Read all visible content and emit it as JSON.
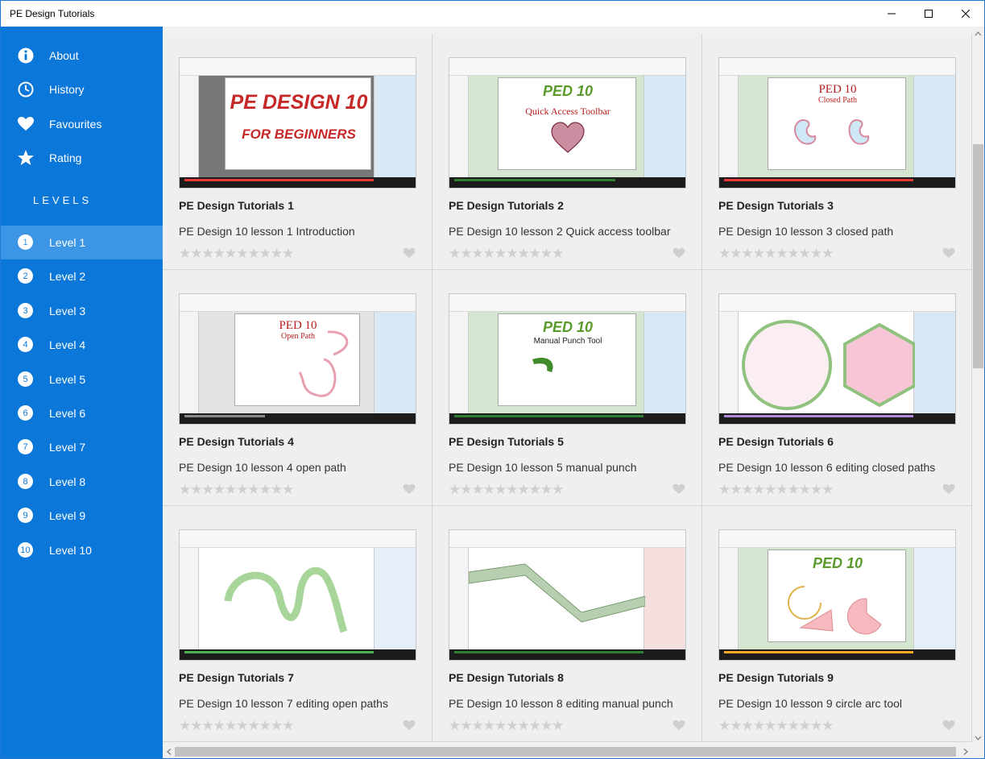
{
  "window": {
    "title": "PE Design Tutorials"
  },
  "sidebar": {
    "nav": [
      {
        "label": "About",
        "icon": "info-icon"
      },
      {
        "label": "History",
        "icon": "clock-icon"
      },
      {
        "label": "Favourites",
        "icon": "heart-icon"
      },
      {
        "label": "Rating",
        "icon": "star-icon"
      }
    ],
    "levels_heading": "LEVELS",
    "levels": [
      {
        "num": "1",
        "label": "Level 1",
        "active": true
      },
      {
        "num": "2",
        "label": "Level 2"
      },
      {
        "num": "3",
        "label": "Level 3"
      },
      {
        "num": "4",
        "label": "Level 4"
      },
      {
        "num": "5",
        "label": "Level 5"
      },
      {
        "num": "6",
        "label": "Level 6"
      },
      {
        "num": "7",
        "label": "Level 7"
      },
      {
        "num": "8",
        "label": "Level 8"
      },
      {
        "num": "9",
        "label": "Level 9"
      },
      {
        "num": "10",
        "label": "Level 10"
      }
    ]
  },
  "cards": [
    {
      "title": "PE Design Tutorials 1",
      "desc": "PE Design 10 lesson 1 Introduction",
      "thumb_line1": "PE DESIGN 10",
      "thumb_line2": "FOR BEGINNERS"
    },
    {
      "title": "PE Design Tutorials 2",
      "desc": "PE Design 10 lesson 2 Quick access toolbar",
      "thumb_line1": "PED 10",
      "thumb_line2": "Quick Access Toolbar"
    },
    {
      "title": "PE Design Tutorials 3",
      "desc": "PE Design 10 lesson 3 closed path",
      "thumb_line1": "PED 10",
      "thumb_line2": "Closed Path"
    },
    {
      "title": "PE Design Tutorials 4",
      "desc": "PE Design 10 lesson 4 open path",
      "thumb_line1": "PED 10",
      "thumb_line2": "Open Path"
    },
    {
      "title": "PE Design Tutorials 5",
      "desc": "PE Design 10 lesson 5 manual punch",
      "thumb_line1": "PED 10",
      "thumb_line2": "Manual Punch Tool"
    },
    {
      "title": "PE Design Tutorials 6",
      "desc": "PE Design 10 lesson 6 editing closed paths",
      "thumb_line1": "",
      "thumb_line2": ""
    },
    {
      "title": "PE Design Tutorials 7",
      "desc": "PE Design 10 lesson 7 editing open paths",
      "thumb_line1": "",
      "thumb_line2": ""
    },
    {
      "title": "PE Design Tutorials 8",
      "desc": "PE Design 10 lesson 8 editing manual punch",
      "thumb_line1": "",
      "thumb_line2": ""
    },
    {
      "title": "PE Design Tutorials 9",
      "desc": "PE Design 10 lesson 9 circle arc tool",
      "thumb_line1": "PED 10",
      "thumb_line2": ""
    }
  ],
  "rating": {
    "stars": "★★★★★★★★★★"
  },
  "colors": {
    "accent": "#0a77d9",
    "active_level": "#3d95e5",
    "content_bg": "#efefef"
  }
}
